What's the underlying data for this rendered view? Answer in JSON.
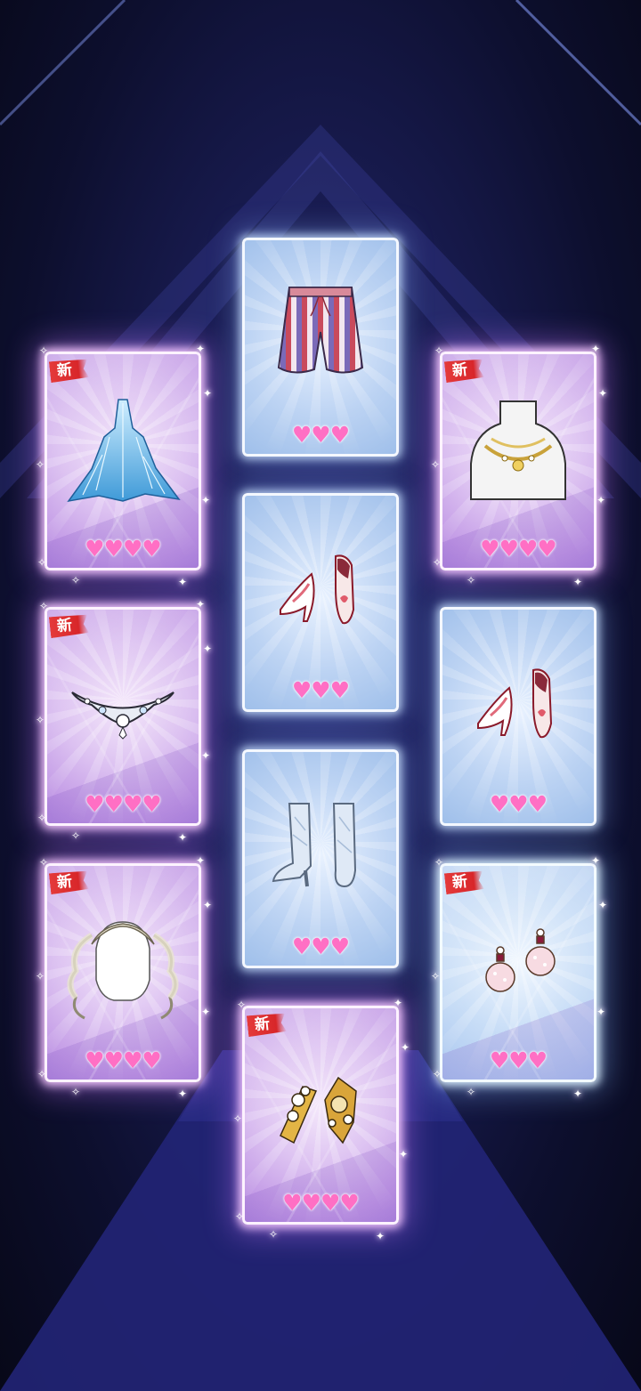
{
  "screen": {
    "name": "item-reveal"
  },
  "badge_text": "新",
  "heart_glyph": "♥",
  "colors": {
    "heart": "#ff6fc4",
    "badge": "#d8262a",
    "rare_glow": "#c39be6",
    "common_frame": "#bcd3f3"
  },
  "cards": [
    {
      "id": "card-gown",
      "item": "crystal-gown-icon",
      "rarity": "rare",
      "is_new": true,
      "hearts": 4
    },
    {
      "id": "card-shorts",
      "item": "striped-shorts-icon",
      "rarity": "common",
      "is_new": false,
      "hearts": 3
    },
    {
      "id": "card-necklace",
      "item": "gold-necklace-icon",
      "rarity": "rare",
      "is_new": true,
      "hearts": 4
    },
    {
      "id": "card-heels-1",
      "item": "pink-heels-icon",
      "rarity": "common",
      "is_new": false,
      "hearts": 3
    },
    {
      "id": "card-tiara",
      "item": "jeweled-tiara-icon",
      "rarity": "rare",
      "is_new": true,
      "hearts": 4
    },
    {
      "id": "card-heels-2",
      "item": "pink-heels-icon",
      "rarity": "common",
      "is_new": false,
      "hearts": 3
    },
    {
      "id": "card-boots",
      "item": "crystal-boots-icon",
      "rarity": "common",
      "is_new": false,
      "hearts": 3
    },
    {
      "id": "card-wig",
      "item": "curly-twin-tail-wig-icon",
      "rarity": "rare",
      "is_new": true,
      "hearts": 4
    },
    {
      "id": "card-earrings",
      "item": "pearl-earrings-icon",
      "rarity": "rare-blue",
      "is_new": true,
      "hearts": 3
    },
    {
      "id": "card-hairpins",
      "item": "gold-flower-hairpins-icon",
      "rarity": "rare",
      "is_new": true,
      "hearts": 4
    }
  ]
}
